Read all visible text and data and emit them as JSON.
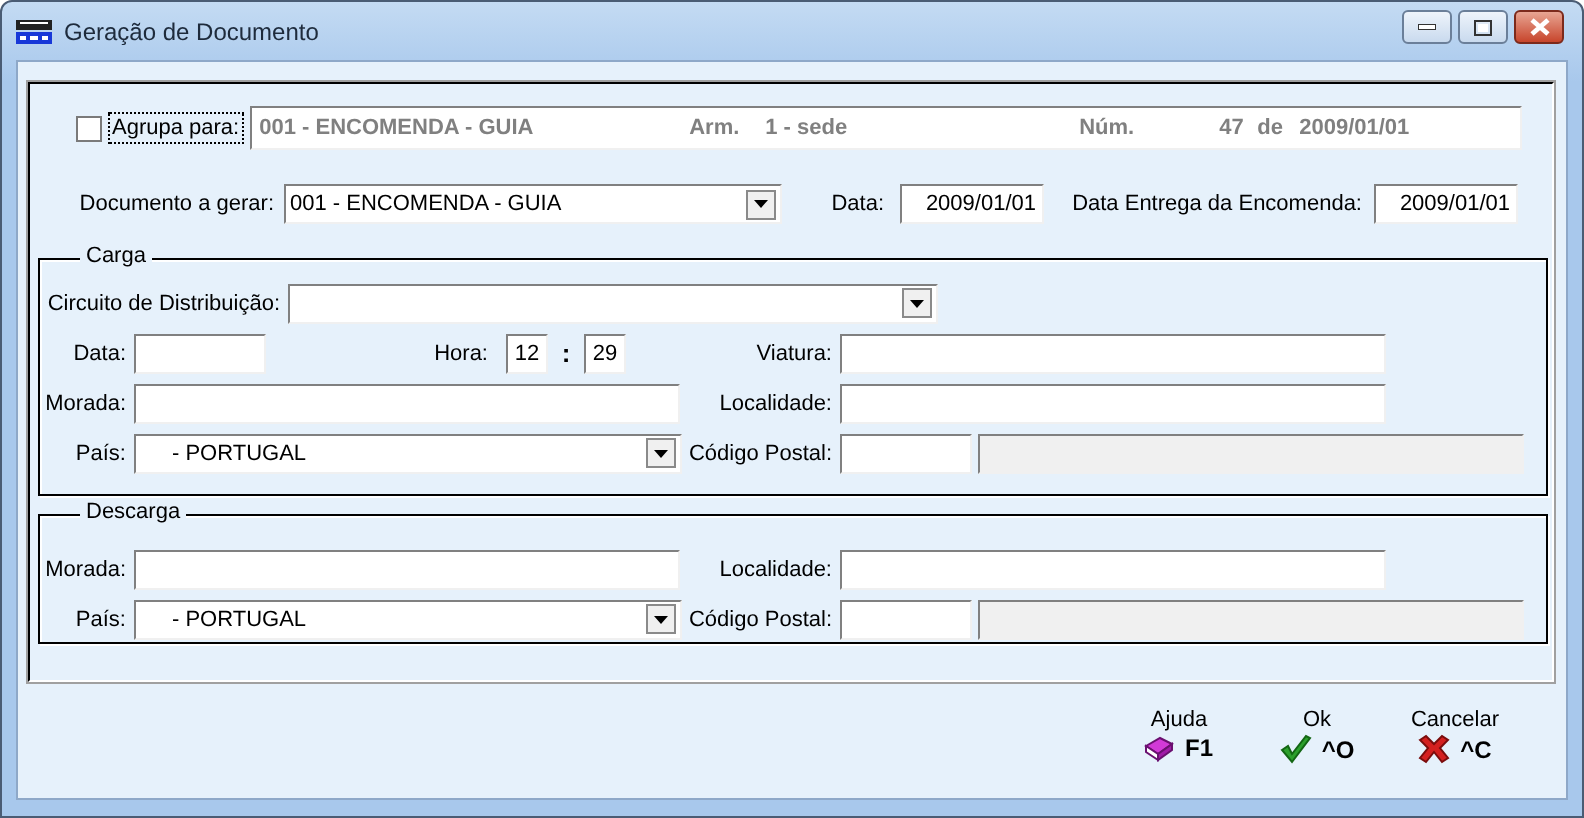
{
  "window": {
    "title": "Geração de Documento"
  },
  "group_for": {
    "label": "Agrupa para:",
    "checked": false,
    "document": "001 - ENCOMENDA - GUIA",
    "warehouse_label": "Arm.",
    "warehouse": "1 - sede",
    "number_label": "Núm.",
    "number": "47",
    "date_label": "de",
    "date": "2009/01/01"
  },
  "document": {
    "label": "Documento a gerar:",
    "value": "001 - ENCOMENDA - GUIA"
  },
  "date": {
    "label": "Data:",
    "value": "2009/01/01"
  },
  "delivery_date": {
    "label": "Data Entrega da Encomenda:",
    "value": "2009/01/01"
  },
  "loading": {
    "title": "Carga",
    "circuit_label": "Circuito de Distribuição:",
    "date_label": "Data:",
    "hour_label": "Hora:",
    "hour": "12",
    "separator": ":",
    "minute": "29",
    "vehicle_label": "Viatura:",
    "address_label": "Morada:",
    "locality_label": "Localidade:",
    "country_label": "País:",
    "country": "- PORTUGAL",
    "postal_label": "Código Postal:"
  },
  "unloading": {
    "title": "Descarga",
    "address_label": "Morada:",
    "locality_label": "Localidade:",
    "country_label": "País:",
    "country": "- PORTUGAL",
    "postal_label": "Código Postal:"
  },
  "actions": [
    {
      "label": "Ajuda",
      "kind": "help",
      "shortcut": "F1"
    },
    {
      "label": "Ok",
      "kind": "ok",
      "shortcut": "^O"
    },
    {
      "label": "Cancelar",
      "kind": "cancel",
      "shortcut": "^C"
    }
  ]
}
